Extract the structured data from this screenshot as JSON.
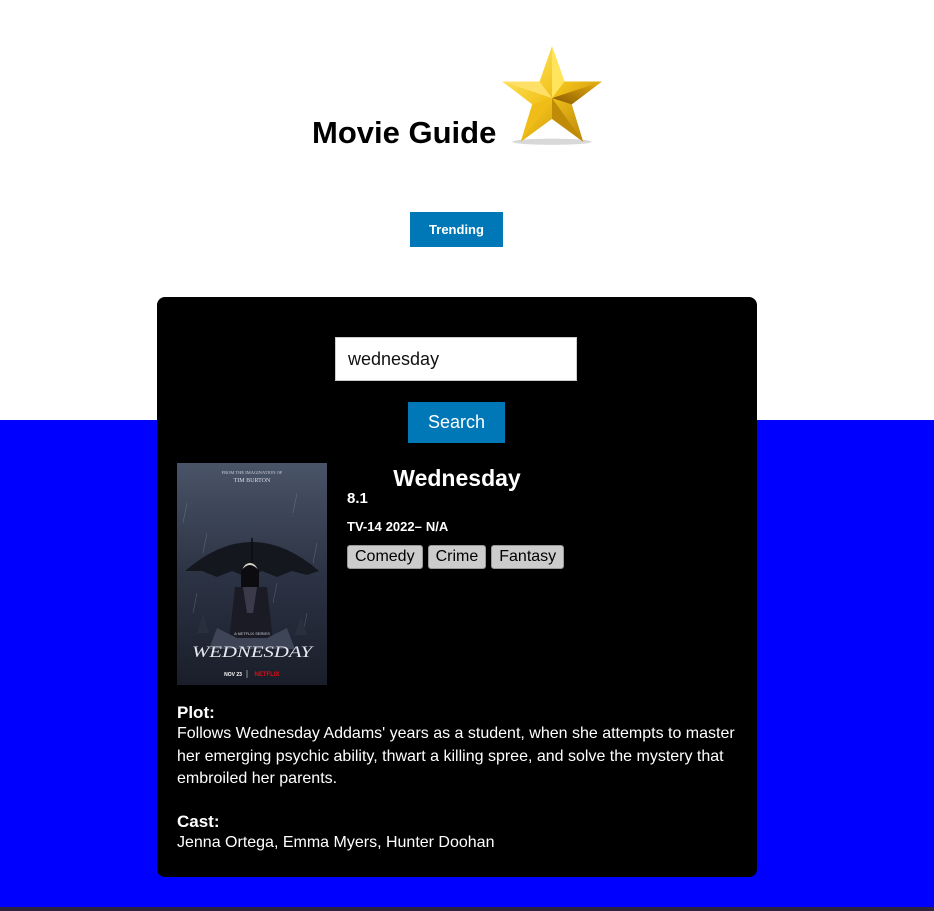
{
  "header": {
    "title": "Movie Guide",
    "logo_icon": "star-icon"
  },
  "nav": {
    "trending_label": "Trending"
  },
  "search": {
    "value": "wednesday",
    "button_label": "Search"
  },
  "result": {
    "title": "Wednesday",
    "rating": "8.1",
    "rated": "TV-14",
    "year": "2022–",
    "runtime": "N/A",
    "genres": [
      "Comedy",
      "Crime",
      "Fantasy"
    ],
    "plot_label": "Plot:",
    "plot": "Follows Wednesday Addams' years as a student, when she attempts to master her emerging psychic ability, thwart a killing spree, and solve the mystery that embroiled her parents.",
    "cast_label": "Cast:",
    "cast": "Jenna Ortega, Emma Myers, Hunter Doohan",
    "poster": {
      "top_credit": "FROM THE IMAGINATION OF",
      "top_name": "TIM BURTON",
      "series_label": "A NETFLIX SERIES",
      "logo_text": "WEDNESDAY",
      "date": "NOV 23",
      "network": "NETFLIX"
    }
  },
  "colors": {
    "accent": "#0078b8",
    "page_bottom": "#0000ff",
    "card": "#000000"
  }
}
